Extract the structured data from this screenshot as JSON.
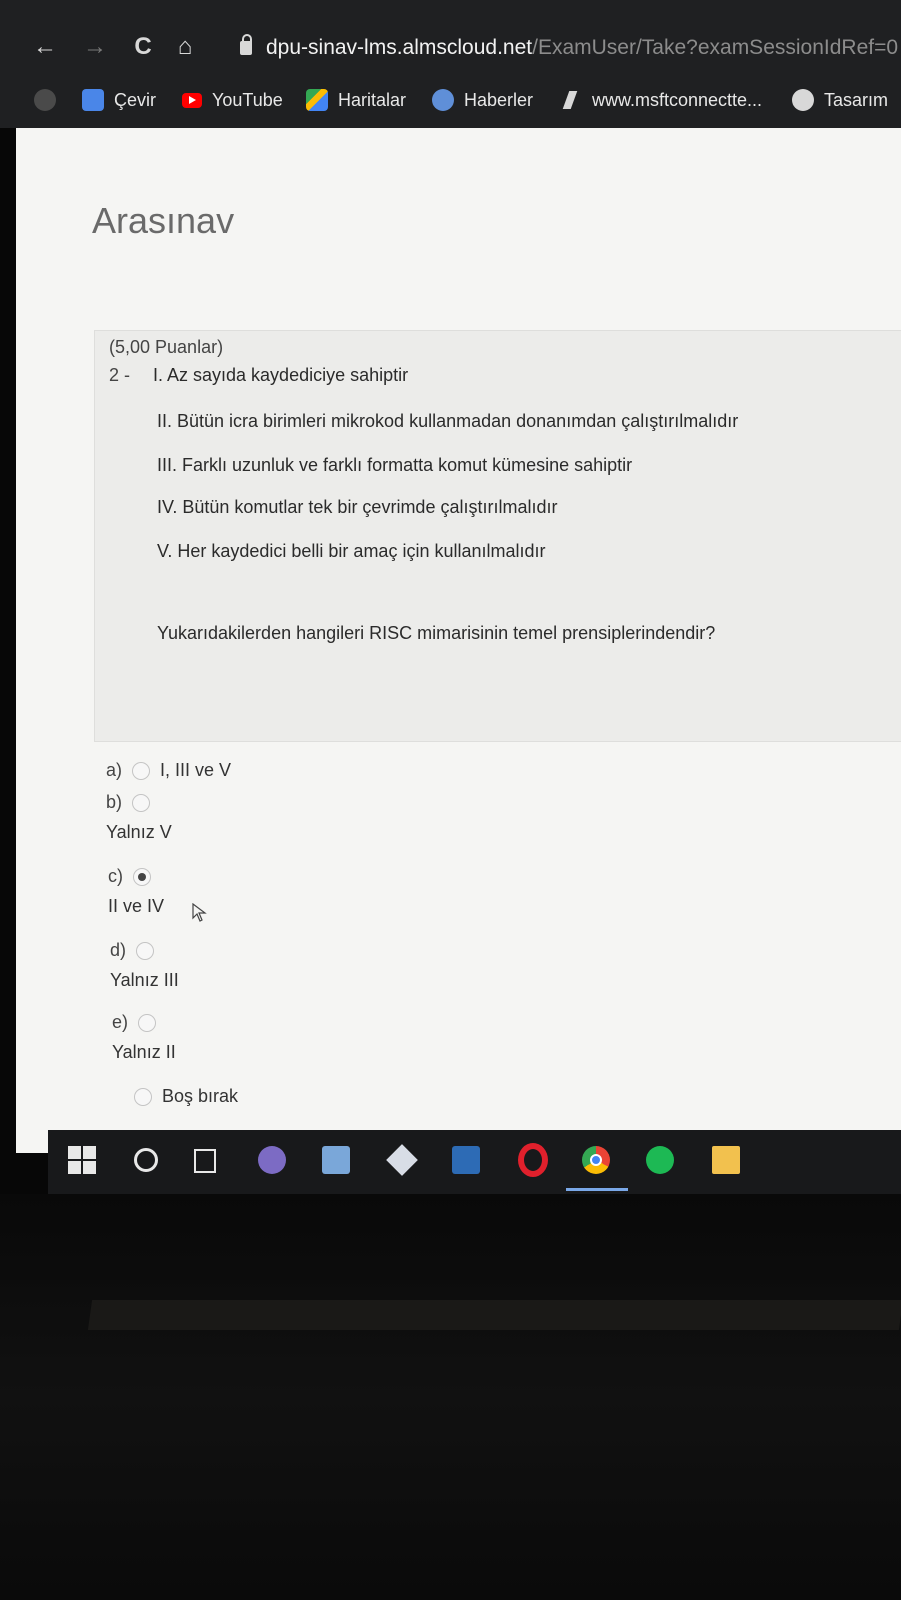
{
  "browser": {
    "nav": {
      "back": "←",
      "forward": "→",
      "reload": "C",
      "home": "⌂"
    },
    "url": {
      "host": "dpu-sinav-lms.almscloud.net",
      "path": "/ExamUser/Take?examSessionIdRef=0"
    },
    "bookmarks": [
      {
        "label": "",
        "icon": "google-icon"
      },
      {
        "label": "Çevir",
        "icon": "translate-icon"
      },
      {
        "label": "YouTube",
        "icon": "youtube-icon"
      },
      {
        "label": "Haritalar",
        "icon": "maps-icon"
      },
      {
        "label": "Haberler",
        "icon": "news-icon"
      },
      {
        "label": "www.msftconnectte...",
        "icon": "msft-icon"
      },
      {
        "label": "Tasarım",
        "icon": "tasarim-icon"
      }
    ]
  },
  "exam": {
    "title": "Arasınav",
    "question": {
      "points": "(5,00 Puanlar)",
      "number": "2 -",
      "statements": [
        "I. Az sayıda kaydediciye sahiptir",
        "II. Bütün icra birimleri mikrokod kullanmadan donanımdan çalıştırılmalıdır",
        "III. Farklı uzunluk ve farklı formatta komut kümesine sahiptir",
        "IV. Bütün komutlar tek bir çevrimde çalıştırılmalıdır",
        "V. Her kaydedici belli bir amaç için kullanılmalıdır"
      ],
      "prompt": "Yukarıdakilerden hangileri RISC mimarisinin temel prensiplerindendir?"
    },
    "options": [
      {
        "letter": "a)",
        "text": "I, III ve V",
        "selected": false
      },
      {
        "letter": "b)",
        "text": "Yalnız V",
        "selected": false
      },
      {
        "letter": "c)",
        "text": "II ve IV",
        "selected": true
      },
      {
        "letter": "d)",
        "text": "Yalnız III",
        "selected": false
      },
      {
        "letter": "e)",
        "text": "Yalnız II",
        "selected": false
      }
    ],
    "leave_blank": "Boş bırak"
  },
  "taskbar": {
    "icons": [
      "windows-start-icon",
      "search-icon",
      "task-view-icon",
      "paint-icon",
      "this-pc-icon",
      "3d-viewer-icon",
      "store-icon",
      "opera-icon",
      "chrome-icon",
      "spotify-icon",
      "file-explorer-icon"
    ],
    "active": "chrome-icon"
  }
}
